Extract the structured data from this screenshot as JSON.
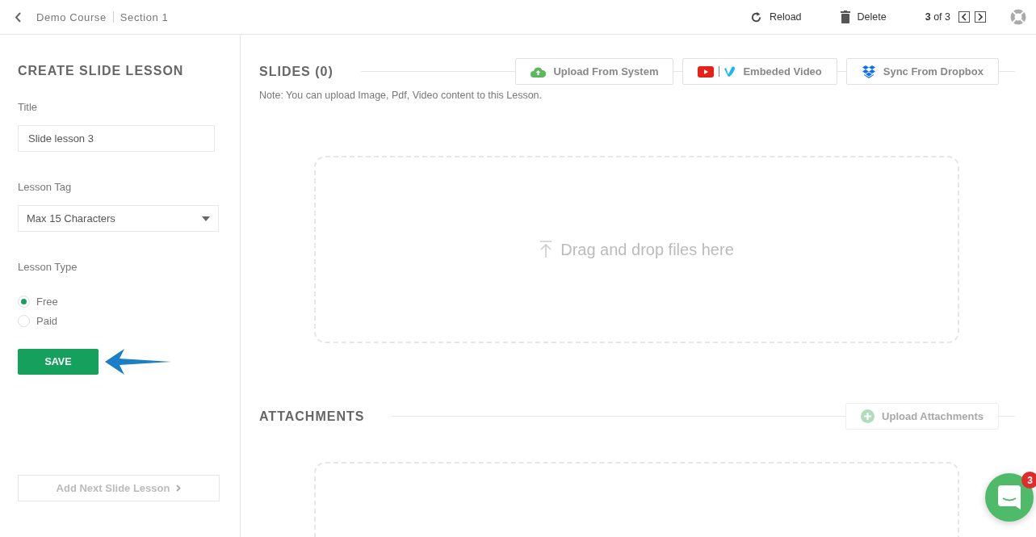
{
  "header": {
    "breadcrumb": [
      "Demo Course",
      "Section 1"
    ],
    "actions": [
      {
        "kind": "reload",
        "label": "Reload"
      },
      {
        "kind": "delete",
        "label": "Delete"
      }
    ],
    "pager": "**3** of 3"
  },
  "sidebar": {
    "title": "CREATE SLIDE LESSON",
    "title_field": {
      "label": "Title",
      "value": "Slide lesson 3"
    },
    "tag_field": {
      "label": "Lesson Tag",
      "value": "Max 15 Characters"
    },
    "lesson_type": {
      "label": "Lesson Type",
      "options": [
        {
          "label": "Free",
          "selected": true
        },
        {
          "label": "Paid",
          "selected": false
        }
      ]
    },
    "save_button": "SAVE",
    "next_button": {
      "label": "Add Next Slide Lesson",
      "disabled": true
    }
  },
  "slides": {
    "title": "SLIDES (0)",
    "buttons": [
      {
        "kind": "system",
        "label": "Upload From System",
        "disabled": false
      },
      {
        "kind": "video",
        "label": "Embeded Video",
        "disabled": false
      },
      {
        "kind": "dropbox",
        "label": "Sync From Dropbox",
        "disabled": false
      }
    ],
    "note": "Note: You can upload Image, Pdf, Video content to this Lesson.",
    "dropzone": "Drag and drop files here"
  },
  "attachments": {
    "title": "ATTACHMENTS",
    "buttons": [
      {
        "kind": "add",
        "label": "Upload Attachments",
        "disabled": true
      }
    ]
  },
  "chat": {
    "badge": "3"
  }
}
